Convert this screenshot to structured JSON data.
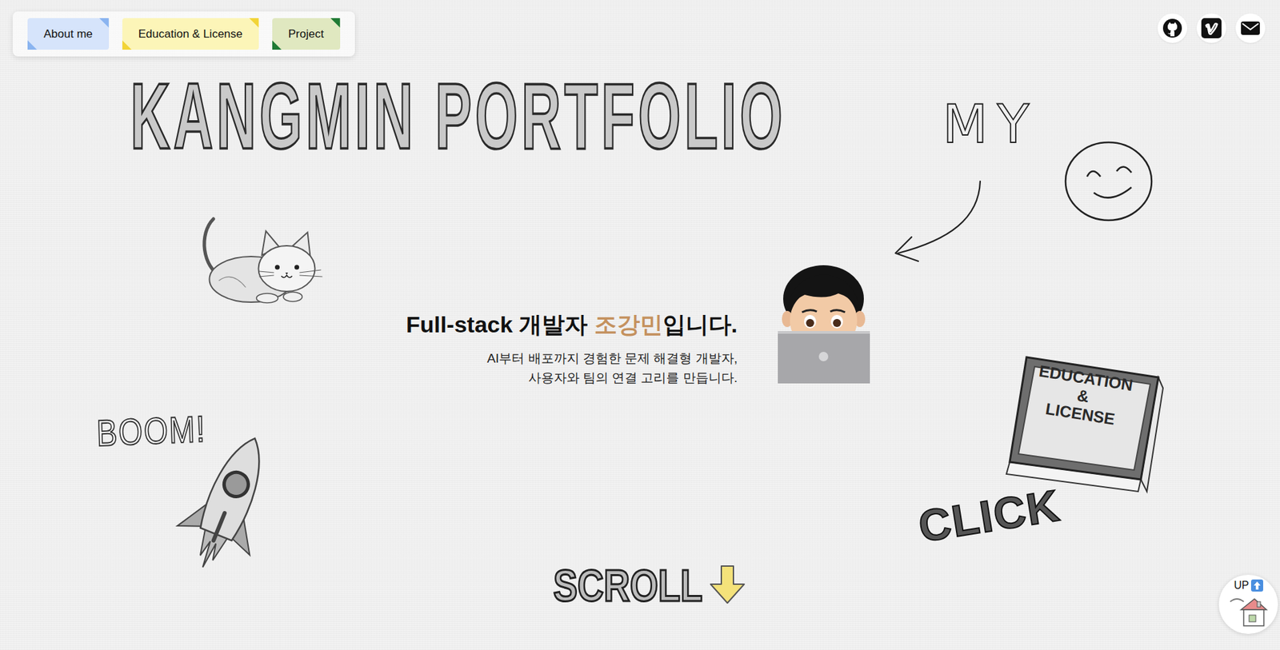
{
  "nav": {
    "tabs": [
      {
        "label": "About me",
        "selected": false,
        "color": "#d6e4fb",
        "accent": "#8ab4f0"
      },
      {
        "label": "Education & License",
        "selected": false,
        "color": "#fcf5b8",
        "accent": "#f2d437"
      },
      {
        "label": "Project",
        "selected": false,
        "color": "#e0e8c0",
        "accent": "#1f7a34"
      }
    ]
  },
  "title": "KANGMIN PORTFOLIO",
  "hero": {
    "heading_before": "Full-stack 개발자 ",
    "highlight": "조강민",
    "heading_after": "입니다.",
    "lines": [
      "AI부터 배포까지 경험한 문제 해결형 개발자,",
      "사용자와 팀의 연결 고리를 만듭니다."
    ]
  },
  "doodles": {
    "my": "MY",
    "boom": "BOOM!",
    "book": [
      "EDUCATION",
      "&",
      "LICENSE"
    ],
    "click": "CLICK",
    "scroll": "SCROLL"
  },
  "up_button": {
    "label": "UP"
  }
}
